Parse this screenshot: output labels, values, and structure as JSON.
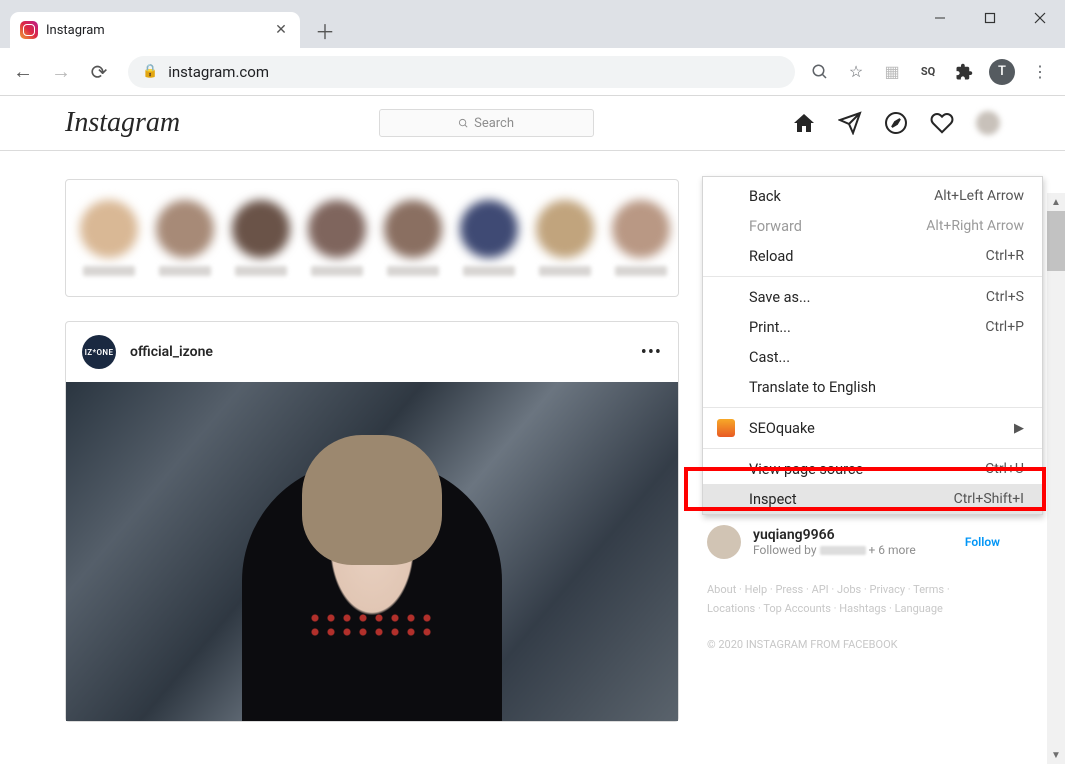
{
  "browser": {
    "tab_title": "Instagram",
    "url": "instagram.com",
    "avatar_initial": "T"
  },
  "instagram": {
    "logo": "Instagram",
    "search_placeholder": "Search",
    "post_user": "official_izone",
    "post_avatar_label": "IZ*ONE",
    "suggestion": {
      "name": "yuqiang9966",
      "sub_prefix": "Followed by",
      "sub_suffix": "+ 6 more",
      "follow": "Follow"
    },
    "footer": "About · Help · Press · API · Jobs · Privacy · Terms · Locations · Top Accounts · Hashtags · Language",
    "copyright": "© 2020 INSTAGRAM FROM FACEBOOK"
  },
  "context_menu": {
    "back": {
      "label": "Back",
      "shortcut": "Alt+Left Arrow"
    },
    "forward": {
      "label": "Forward",
      "shortcut": "Alt+Right Arrow"
    },
    "reload": {
      "label": "Reload",
      "shortcut": "Ctrl+R"
    },
    "save_as": {
      "label": "Save as...",
      "shortcut": "Ctrl+S"
    },
    "print": {
      "label": "Print...",
      "shortcut": "Ctrl+P"
    },
    "cast": {
      "label": "Cast..."
    },
    "translate": {
      "label": "Translate to English"
    },
    "seoquake": {
      "label": "SEOquake"
    },
    "view_source": {
      "label": "View page source",
      "shortcut": "Ctrl+U"
    },
    "inspect": {
      "label": "Inspect",
      "shortcut": "Ctrl+Shift+I"
    }
  }
}
